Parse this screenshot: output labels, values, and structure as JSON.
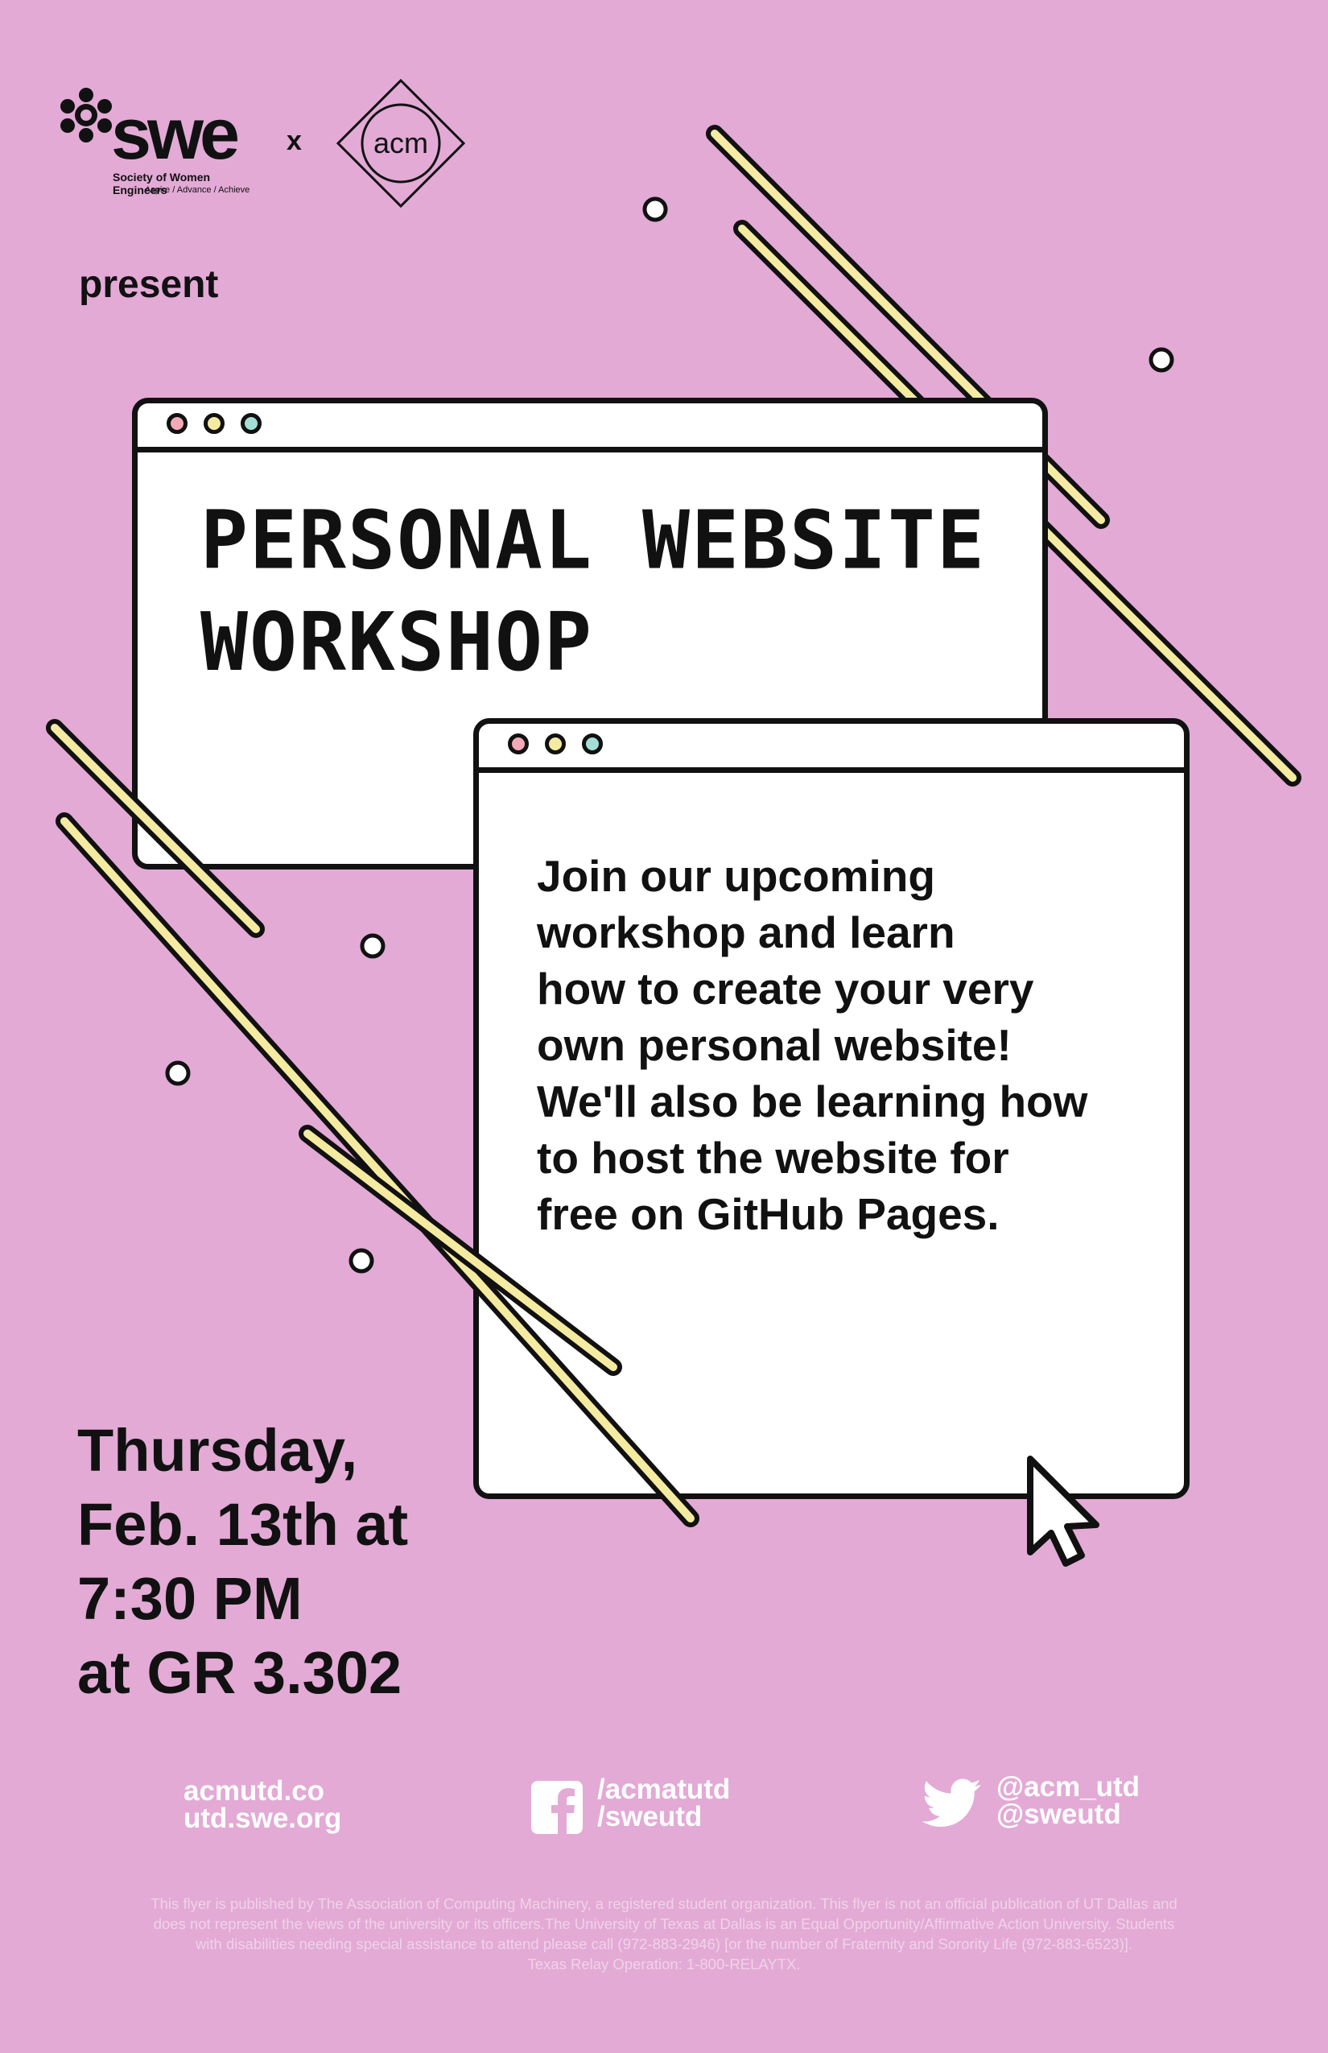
{
  "colors": {
    "background": "#e3aad6",
    "stripe": "#f4eba0",
    "outline": "#111111",
    "dot_pink": "#f4a9b5",
    "dot_yellow": "#f4eba0",
    "dot_teal": "#a3dfd5"
  },
  "logos": {
    "swe": {
      "word": "swe",
      "tm": "™",
      "tagline": "Society of Women Engineers",
      "sub_tagline": "Aspire / Advance / Achieve"
    },
    "separator": "x",
    "acm": {
      "word": "acm"
    }
  },
  "intro": "present",
  "headline": {
    "line1": "PERSONAL WEBSITE",
    "line2": "WORKSHOP"
  },
  "description": [
    "Join our upcoming",
    "workshop and learn",
    "how to create your very",
    "own personal website!",
    "We'll also be learning how",
    "to host the website for",
    "free on GitHub Pages."
  ],
  "event": {
    "line1": "Thursday,",
    "line2": "Feb. 13th at",
    "line3": "7:30 PM",
    "line4": "at GR 3.302"
  },
  "contacts": {
    "websites": [
      "acmutd.co",
      "utd.swe.org"
    ],
    "facebook": {
      "icon": "facebook-icon",
      "handles": [
        "/acmatutd",
        "/sweutd"
      ]
    },
    "twitter": {
      "icon": "twitter-icon",
      "handles": [
        "@acm_utd",
        "@sweutd"
      ]
    }
  },
  "disclaimer": [
    "This flyer is published by The Association of Computing Machinery, a registered student organization. This flyer is not an official publication of UT Dallas and",
    "does not represent the views of the university or its officers.The University of Texas at Dallas is an Equal Opportunity/Affirmative Action University. Students",
    "with disabilities needing special assistance to attend please call (972-883-2946) [or the number of Fraternity and Sorority Life (972-883-6523)].",
    "Texas Relay Operation: 1-800-RELAYTX."
  ]
}
